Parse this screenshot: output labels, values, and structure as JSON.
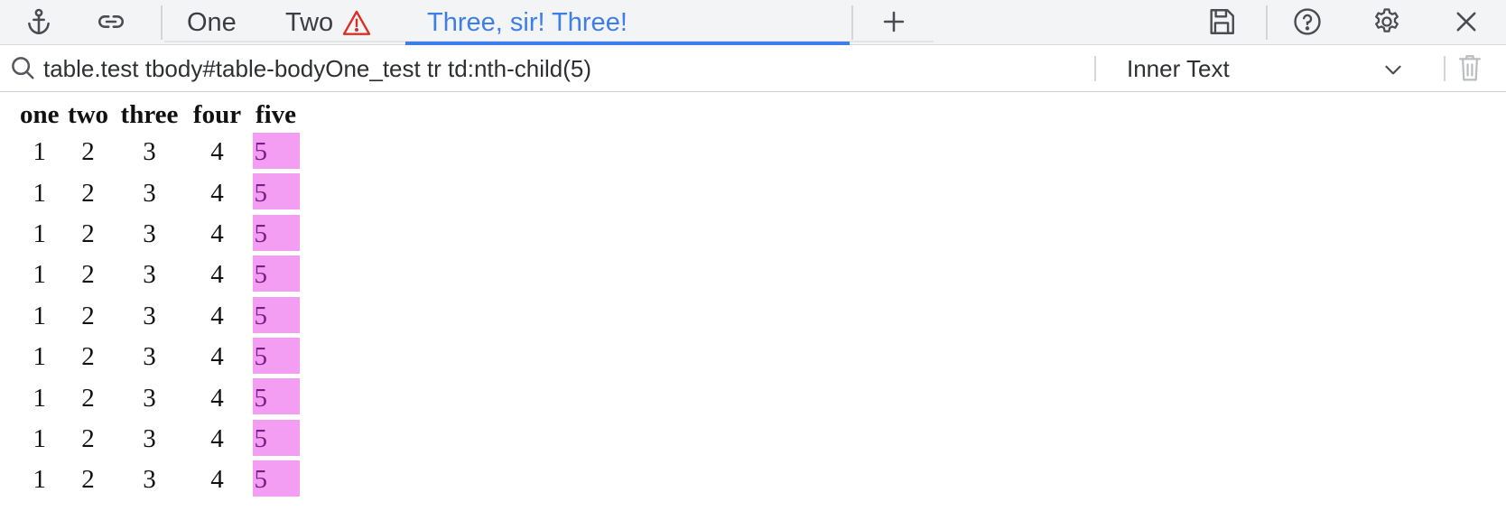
{
  "toolbar": {
    "icons": [
      "anchor-icon",
      "link-icon",
      "plus-icon",
      "save-icon",
      "help-icon",
      "gear-icon",
      "close-icon"
    ],
    "tabs": [
      {
        "label": "One",
        "warning": false,
        "active": false
      },
      {
        "label": "Two",
        "warning": true,
        "active": false
      },
      {
        "label": "Three, sir! Three!",
        "warning": false,
        "active": true
      }
    ]
  },
  "selector": {
    "value": "table.test tbody#table-bodyOne_test tr td:nth-child(5)",
    "mode": "Inner Text"
  },
  "colors": {
    "accent": "#3d7eea",
    "warning": "#d93025",
    "highlight": "#f39ef3",
    "highlight_text": "#7a1c8a"
  },
  "table": {
    "headers": [
      "one",
      "two",
      "three",
      "four",
      "five"
    ],
    "rows": [
      [
        "1",
        "2",
        "3",
        "4",
        "5"
      ],
      [
        "1",
        "2",
        "3",
        "4",
        "5"
      ],
      [
        "1",
        "2",
        "3",
        "4",
        "5"
      ],
      [
        "1",
        "2",
        "3",
        "4",
        "5"
      ],
      [
        "1",
        "2",
        "3",
        "4",
        "5"
      ],
      [
        "1",
        "2",
        "3",
        "4",
        "5"
      ],
      [
        "1",
        "2",
        "3",
        "4",
        "5"
      ],
      [
        "1",
        "2",
        "3",
        "4",
        "5"
      ],
      [
        "1",
        "2",
        "3",
        "4",
        "5"
      ]
    ],
    "highlighted_column": 5
  }
}
